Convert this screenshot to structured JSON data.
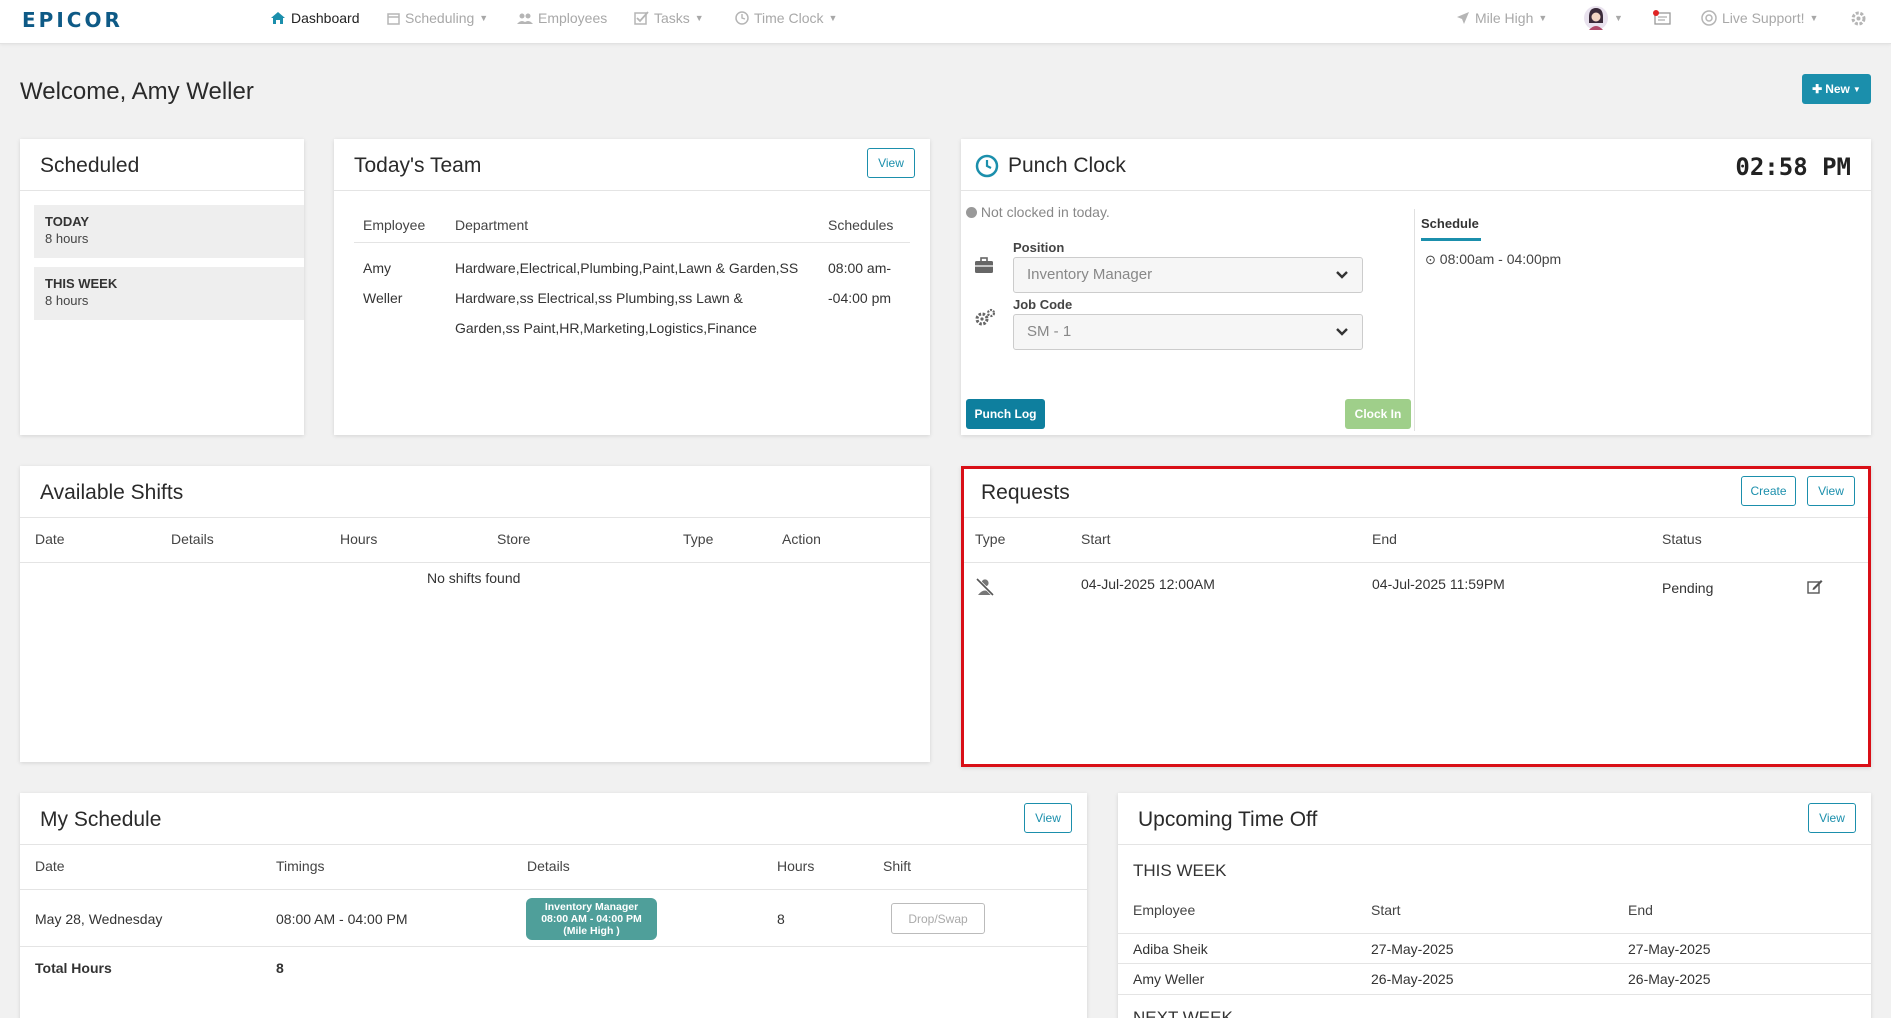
{
  "nav": {
    "logo": "EPICOR",
    "items": [
      {
        "label": "Dashboard",
        "icon": "home-icon",
        "active": true
      },
      {
        "label": "Scheduling",
        "icon": "calendar-icon"
      },
      {
        "label": "Employees",
        "icon": "users-icon"
      },
      {
        "label": "Tasks",
        "icon": "checkbox-icon"
      },
      {
        "label": "Time Clock",
        "icon": "clock-icon"
      }
    ],
    "store": "Mile High",
    "support": "Live Support!"
  },
  "page": {
    "welcome": "Welcome, Amy Weller",
    "new_button": "New"
  },
  "scheduled": {
    "title": "Scheduled",
    "today_label": "TODAY",
    "today_value": "8 hours",
    "week_label": "THIS WEEK",
    "week_value": "8 hours"
  },
  "team": {
    "title": "Today's Team",
    "view": "View",
    "headers": [
      "Employee",
      "Department",
      "Schedules"
    ],
    "row": {
      "employee_line1": "Amy",
      "employee_line2": "Weller",
      "dept_line1": "Hardware,Electrical,Plumbing,Paint,Lawn & Garden,SS",
      "dept_line2": "Hardware,ss Electrical,ss Plumbing,ss Lawn &",
      "dept_line3": "Garden,ss Paint,HR,Marketing,Logistics,Finance",
      "sched_line1": "08:00 am-",
      "sched_line2": "-04:00 pm"
    }
  },
  "punch": {
    "title": "Punch Clock",
    "time": "02:58 PM",
    "status": "Not clocked in today.",
    "position_label": "Position",
    "position_value": "Inventory Manager",
    "job_label": "Job Code",
    "job_value": "SM - 1",
    "schedule_label": "Schedule",
    "schedule_value": "08:00am - 04:00pm",
    "punch_log": "Punch Log",
    "clock_in": "Clock In"
  },
  "shifts": {
    "title": "Available Shifts",
    "headers": [
      "Date",
      "Details",
      "Hours",
      "Store",
      "Type",
      "Action"
    ],
    "empty": "No shifts found"
  },
  "requests": {
    "title": "Requests",
    "create": "Create",
    "view": "View",
    "headers": [
      "Type",
      "Start",
      "End",
      "Status"
    ],
    "rows": [
      {
        "type_icon": "user-slash-icon",
        "start": "04-Jul-2025 12:00AM",
        "end": "04-Jul-2025 11:59PM",
        "status": "Pending"
      }
    ]
  },
  "my_schedule": {
    "title": "My Schedule",
    "view": "View",
    "headers": [
      "Date",
      "Timings",
      "Details",
      "Hours",
      "Shift"
    ],
    "row": {
      "date": "May 28, Wednesday",
      "timings": "08:00 AM - 04:00 PM",
      "detail_line1": "Inventory Manager",
      "detail_line2": "08:00 AM - 04:00 PM",
      "detail_line3": "(Mile High )",
      "hours": "8",
      "action": "Drop/Swap"
    },
    "total_label": "Total Hours",
    "total_value": "8"
  },
  "time_off": {
    "title": "Upcoming Time Off",
    "view": "View",
    "this_week": "THIS WEEK",
    "headers": [
      "Employee",
      "Start",
      "End"
    ],
    "rows": [
      {
        "employee": "Adiba Sheik",
        "start": "27-May-2025",
        "end": "27-May-2025"
      },
      {
        "employee": "Amy Weller",
        "start": "26-May-2025",
        "end": "26-May-2025"
      }
    ],
    "next_week": "NEXT WEEK"
  },
  "colors": {
    "brand": "#0e5a86",
    "accent": "#1b8fac",
    "clock_in_disabled": "#9fcf8a",
    "highlight": "#d90f17",
    "shift_badge": "#4f9f9a"
  }
}
